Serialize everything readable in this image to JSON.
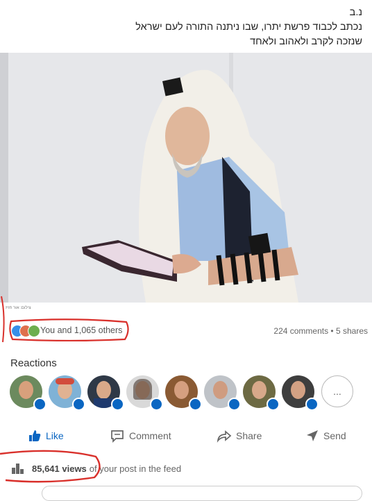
{
  "post": {
    "line1": "נ.ב",
    "line2": "נכתב לכבוד פרשת יתרו, שבו ניתנה התורה לעם ישראל",
    "line3": "שנזכה לקרב ולאהוב ולאחד",
    "photo_credit": "צילום: אור חזיז"
  },
  "social": {
    "reactions_text": "You and 1,065 others",
    "comments_shares": "224 comments • 5 shares",
    "reactions_title": "Reactions",
    "more_label": "..."
  },
  "actions": {
    "like": "Like",
    "comment": "Comment",
    "share": "Share",
    "send": "Send"
  },
  "views": {
    "count": "85,641 views",
    "suffix": "of your post in the feed"
  },
  "colors": {
    "accent": "#0a66c2",
    "annotation": "#d9302b"
  }
}
